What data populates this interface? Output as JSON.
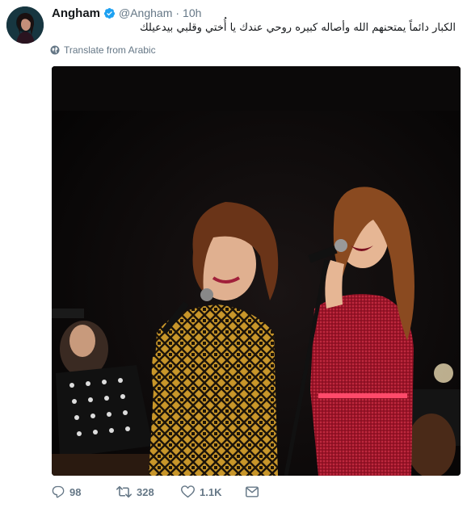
{
  "tweet": {
    "display_name": "Angham",
    "handle": "@Angham",
    "separator": "·",
    "time": "10h",
    "text": "الكبار دائماً يمتحنهم الله وأصاله كبيره  روحي عندك يا أُختي وقلبي بيدعيلك",
    "translate_label": "Translate from Arabic"
  },
  "actions": {
    "replies": "98",
    "retweets": "328",
    "likes": "1.1K"
  },
  "icons": {
    "verified": "verified-badge-icon",
    "globe": "globe-icon",
    "reply": "reply-icon",
    "retweet": "retweet-icon",
    "like": "heart-icon",
    "message": "envelope-icon"
  },
  "colors": {
    "verified_blue": "#1da1f2",
    "secondary_text": "#657786",
    "gold_dress": "#c8962a",
    "red_dress": "#a3142a"
  }
}
